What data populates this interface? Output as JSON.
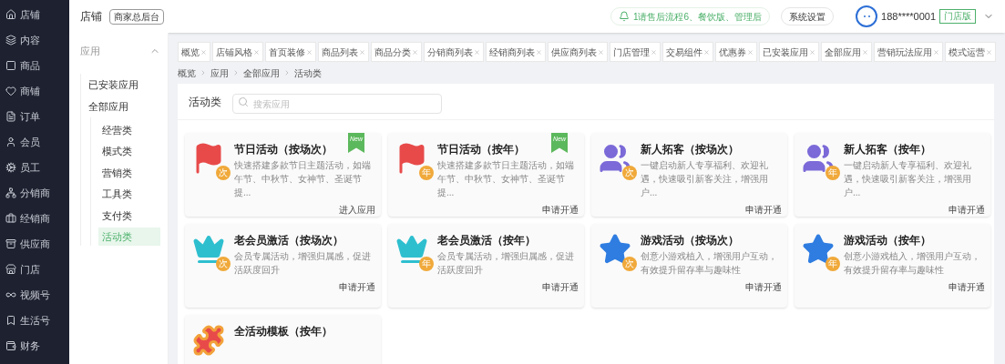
{
  "sidebar": {
    "items": [
      {
        "label": "店铺"
      },
      {
        "label": "内容"
      },
      {
        "label": "商品"
      },
      {
        "label": "商铺"
      },
      {
        "label": "订单"
      },
      {
        "label": "会员"
      },
      {
        "label": "员工"
      },
      {
        "label": "分销商"
      },
      {
        "label": "经销商"
      },
      {
        "label": "供应商"
      },
      {
        "label": "门店"
      },
      {
        "label": "视频号"
      },
      {
        "label": "生活号"
      },
      {
        "label": "财务"
      }
    ]
  },
  "header": {
    "title": "店铺",
    "badge": "商家总后台",
    "notice": "1请售后流程6、餐饮版、管理后",
    "settings": "系统设置",
    "phone": "188****0001",
    "edition": "门店版"
  },
  "submenu": {
    "title": "应用",
    "expanded": true,
    "items": [
      {
        "label": "已安装应用",
        "selected": false
      },
      {
        "label": "全部应用",
        "selected": false,
        "children": [
          {
            "label": "经营类",
            "selected": false
          },
          {
            "label": "模式类",
            "selected": false
          },
          {
            "label": "营销类",
            "selected": false
          },
          {
            "label": "工具类",
            "selected": false
          },
          {
            "label": "支付类",
            "selected": false
          },
          {
            "label": "活动类",
            "selected": true
          }
        ]
      }
    ]
  },
  "tabs": [
    "概览",
    "店铺风格",
    "首页装修",
    "商品列表",
    "商品分类",
    "分销商列表",
    "经销商列表",
    "供应商列表",
    "门店管理",
    "交易组件",
    "优惠券",
    "已安装应用",
    "全部应用",
    "营销玩法应用",
    "模式运营"
  ],
  "breadcrumb": [
    "概览",
    "应用",
    "全部应用",
    "活动类"
  ],
  "panel": {
    "title": "活动类",
    "search_placeholder": "搜索应用"
  },
  "cards": [
    {
      "kind": "flag",
      "badge": "次",
      "title": "节日活动（按场次）",
      "description": "快速搭建多款节日主题活动，如端午节、中秋节、女神节、圣诞节提...",
      "action": "进入应用",
      "ribbon": "New"
    },
    {
      "kind": "flag",
      "badge": "年",
      "title": "节日活动（按年）",
      "description": "快速搭建多款节日主题活动，如端午节、中秋节、女神节、圣诞节提...",
      "action": "申请开通",
      "ribbon": "New"
    },
    {
      "kind": "members",
      "badge": "次",
      "title": "新人拓客（按场次）",
      "description": "一键启动新人专享福利、欢迎礼遇，快速吸引新客关注，增强用户...",
      "action": "申请开通"
    },
    {
      "kind": "members",
      "badge": "年",
      "title": "新人拓客（按年）",
      "description": "一键启动新人专享福利、欢迎礼遇，快速吸引新客关注，增强用户...",
      "action": "申请开通"
    },
    {
      "kind": "crown",
      "badge": "次",
      "title": "老会员激活（按场次）",
      "description": "会员专属活动，增强归属感，促进活跃度回升",
      "action": "申请开通"
    },
    {
      "kind": "crown",
      "badge": "年",
      "title": "老会员激活（按年）",
      "description": "会员专属活动，增强归属感，促进活跃度回升",
      "action": "申请开通"
    },
    {
      "kind": "game",
      "badge": "次",
      "title": "游戏活动（按场次）",
      "description": "创意小游戏植入，增强用户互动，有效提升留存率与趣味性",
      "action": "申请开通"
    },
    {
      "kind": "game",
      "badge": "年",
      "title": "游戏活动（按年）",
      "description": "创意小游戏植入，增强用户互动，有效提升留存率与趣味性",
      "action": "申请开通"
    },
    {
      "kind": "puzzle",
      "title": "全活动模板（按年）"
    }
  ]
}
